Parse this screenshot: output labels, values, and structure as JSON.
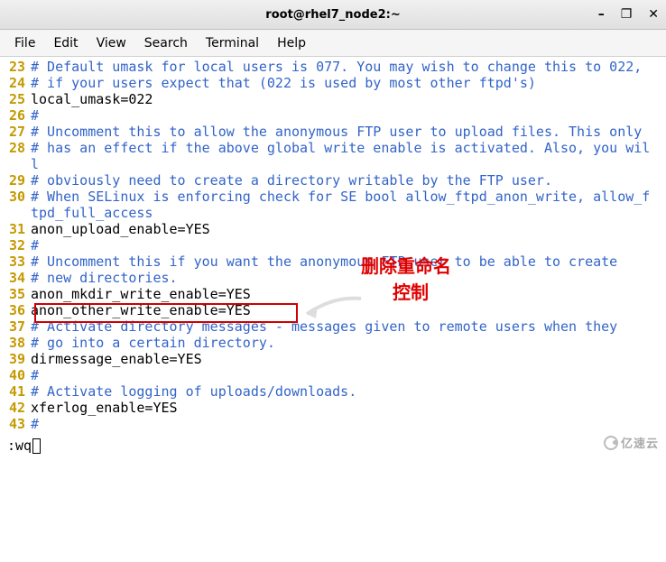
{
  "window": {
    "title": "root@rhel7_node2:~",
    "controls": {
      "minimize": "–",
      "maximize": "❐",
      "close": "✕"
    }
  },
  "menubar": {
    "items": [
      "File",
      "Edit",
      "View",
      "Search",
      "Terminal",
      "Help"
    ]
  },
  "lines": [
    {
      "no": "23",
      "text": "# Default umask for local users is 077. You may wish to change this to 022,",
      "cls": "comment"
    },
    {
      "no": "24",
      "text": "# if your users expect that (022 is used by most other ftpd's)",
      "cls": "comment"
    },
    {
      "no": "25",
      "text": "local_umask=022",
      "cls": "plain"
    },
    {
      "no": "26",
      "text": "#",
      "cls": "comment"
    },
    {
      "no": "27",
      "text": "# Uncomment this to allow the anonymous FTP user to upload files. This only",
      "cls": "comment"
    },
    {
      "no": "28",
      "text": "# has an effect if the above global write enable is activated. Also, you wil",
      "cls": "comment"
    },
    {
      "no": "",
      "text": "l",
      "cls": "comment"
    },
    {
      "no": "29",
      "text": "# obviously need to create a directory writable by the FTP user.",
      "cls": "comment"
    },
    {
      "no": "30",
      "text": "# When SELinux is enforcing check for SE bool allow_ftpd_anon_write, allow_f",
      "cls": "comment"
    },
    {
      "no": "",
      "text": "tpd_full_access",
      "cls": "comment"
    },
    {
      "no": "31",
      "text": "anon_upload_enable=YES",
      "cls": "plain"
    },
    {
      "no": "32",
      "text": "#",
      "cls": "comment"
    },
    {
      "no": "33",
      "text": "# Uncomment this if you want the anonymous FTP user to be able to create",
      "cls": "comment"
    },
    {
      "no": "34",
      "text": "# new directories.",
      "cls": "comment"
    },
    {
      "no": "35",
      "text": "anon_mkdir_write_enable=YES",
      "cls": "plain"
    },
    {
      "no": "36",
      "text": "anon_other_write_enable=YES",
      "cls": "plain"
    },
    {
      "no": "37",
      "text": "# Activate directory messages - messages given to remote users when they",
      "cls": "comment"
    },
    {
      "no": "38",
      "text": "# go into a certain directory.",
      "cls": "comment"
    },
    {
      "no": "39",
      "text": "dirmessage_enable=YES",
      "cls": "plain"
    },
    {
      "no": "40",
      "text": "#",
      "cls": "comment"
    },
    {
      "no": "41",
      "text": "# Activate logging of uploads/downloads.",
      "cls": "comment"
    },
    {
      "no": "42",
      "text": "xferlog_enable=YES",
      "cls": "plain"
    },
    {
      "no": "43",
      "text": "#",
      "cls": "comment"
    }
  ],
  "annotations": {
    "label1": "删除重命名",
    "label2": "控制"
  },
  "cmdline": ":wq",
  "watermark": "亿速云"
}
